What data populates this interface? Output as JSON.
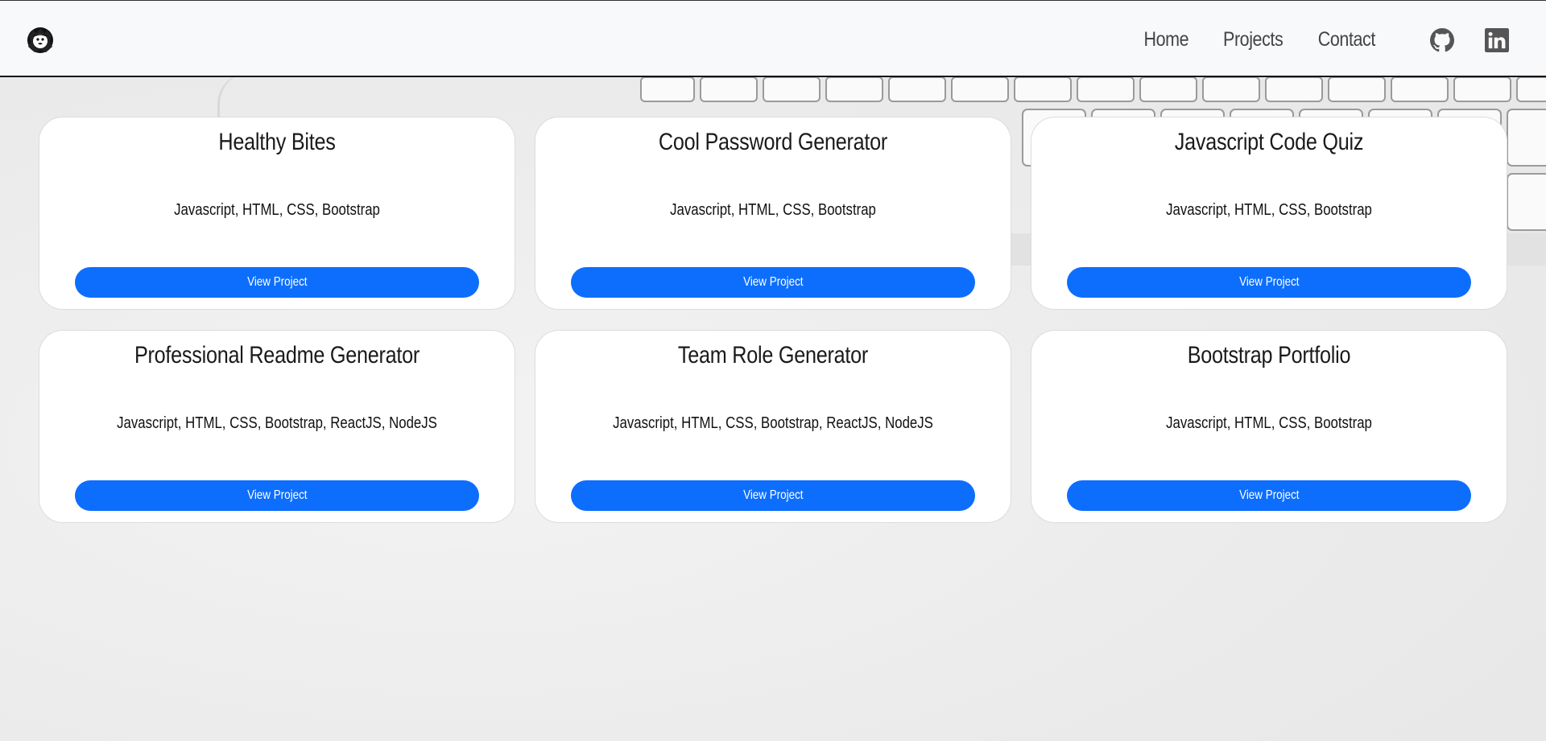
{
  "nav": {
    "brand_icon": "lion-logo-icon",
    "links": [
      {
        "label": "Home"
      },
      {
        "label": "Projects"
      },
      {
        "label": "Contact"
      }
    ],
    "social": [
      {
        "icon": "github-icon"
      },
      {
        "icon": "linkedin-icon"
      }
    ]
  },
  "projects": [
    {
      "title": "Healthy Bites",
      "tech": "Javascript, HTML, CSS, Bootstrap",
      "button": "View Project"
    },
    {
      "title": "Cool Password Generator",
      "tech": "Javascript, HTML, CSS, Bootstrap",
      "button": "View Project"
    },
    {
      "title": "Javascript Code Quiz",
      "tech": "Javascript, HTML, CSS, Bootstrap",
      "button": "View Project"
    },
    {
      "title": "Professional Readme Generator",
      "tech": "Javascript, HTML, CSS, Bootstrap, ReactJS, NodeJS",
      "button": "View Project"
    },
    {
      "title": "Team Role Generator",
      "tech": "Javascript, HTML, CSS, Bootstrap, ReactJS, NodeJS",
      "button": "View Project"
    },
    {
      "title": "Bootstrap Portfolio",
      "tech": "Javascript, HTML, CSS, Bootstrap",
      "button": "View Project"
    }
  ],
  "colors": {
    "accent": "#0d6efd",
    "navbar_bg": "#f8f9fa",
    "card_bg": "#ffffff"
  }
}
